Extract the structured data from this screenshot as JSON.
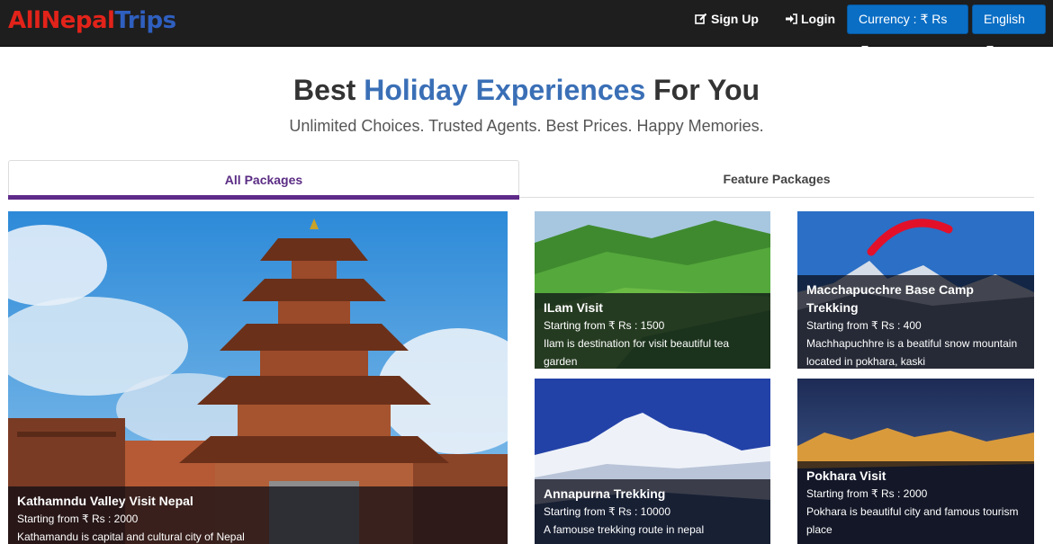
{
  "brand": {
    "part1": "AllNepal",
    "part2": "Trips"
  },
  "nav": {
    "signup": "Sign Up",
    "login": "Login",
    "currency": "Currency : ₹ Rs",
    "language": "English"
  },
  "hero": {
    "title_start": "Best ",
    "title_highlight": "Holiday Experiences",
    "title_end": " For You",
    "subtitle": "Unlimited Choices. Trusted Agents. Best Prices. Happy Memories."
  },
  "tabs": {
    "all": "All Packages",
    "feature": "Feature Packages"
  },
  "packages": [
    {
      "title": "Kathamndu Valley Visit Nepal",
      "price": "Starting from ₹ Rs : 2000",
      "desc": "Kathamandu is capital and cultural city of Nepal"
    },
    {
      "title": "ILam Visit",
      "price": "Starting from ₹ Rs : 1500",
      "desc": "Ilam is destination for visit beautiful tea garden"
    },
    {
      "title": "Macchapucchre Base Camp Trekking",
      "price": "Starting from ₹ Rs : 400",
      "desc": "Machhapuchhre is a beatiful snow mountain located in pokhara, kaski"
    },
    {
      "title": "Annapurna Trekking",
      "price": "Starting from ₹ Rs : 10000",
      "desc": "A famouse trekking route in nepal"
    },
    {
      "title": "Pokhara Visit",
      "price": "Starting from ₹ Rs : 2000",
      "desc": "Pokhara is beautiful city and famous tourism place"
    }
  ],
  "colors": {
    "navbar": "#1e1e1e",
    "brand_red": "#e2231a",
    "brand_blue": "#2f5fbf",
    "button_blue": "#0a6ec5",
    "title_highlight": "#3a6fb6",
    "active_tab": "#5f2b8a"
  }
}
